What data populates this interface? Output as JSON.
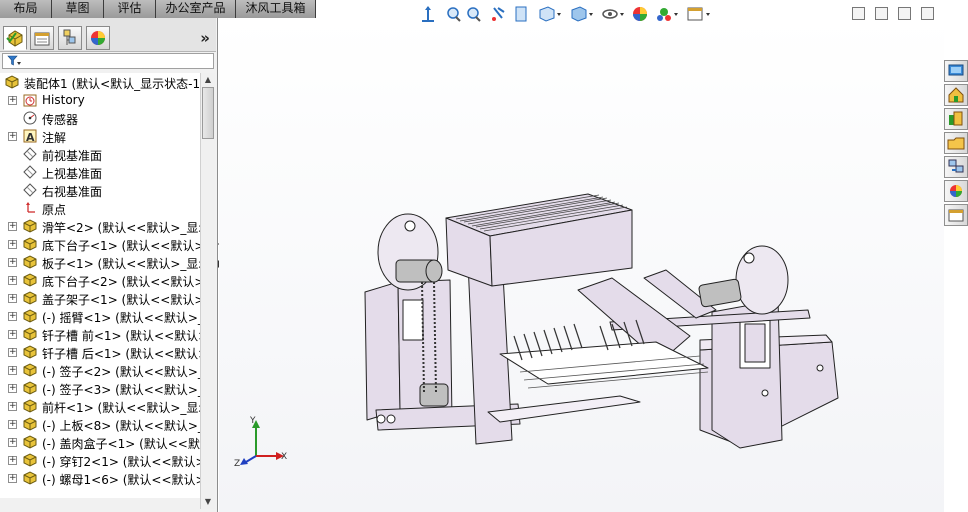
{
  "top_tabs": [
    {
      "label": "布局"
    },
    {
      "label": "草图"
    },
    {
      "label": "评估"
    },
    {
      "label": "办公室产品"
    },
    {
      "label": "沐风工具箱"
    }
  ],
  "panel": {
    "tab_icons": [
      "feature-manager-icon",
      "property-manager-icon",
      "configuration-manager-icon",
      "display-manager-icon"
    ],
    "expand_glyph": "»",
    "filter_icon": "filter-icon"
  },
  "tree": {
    "items": [
      {
        "label": "装配体1 (默认<默认_显示状态-1",
        "icon": "assembly-icon",
        "expander": "none"
      },
      {
        "label": "History",
        "icon": "history-icon",
        "expander": "+"
      },
      {
        "label": "传感器",
        "icon": "sensor-icon",
        "expander": "none"
      },
      {
        "label": "注解",
        "icon": "annotation-icon",
        "expander": "+"
      },
      {
        "label": "前视基准面",
        "icon": "plane-icon",
        "expander": "none"
      },
      {
        "label": "上视基准面",
        "icon": "plane-icon",
        "expander": "none"
      },
      {
        "label": "右视基准面",
        "icon": "plane-icon",
        "expander": "none"
      },
      {
        "label": "原点",
        "icon": "origin-icon",
        "expander": "none"
      },
      {
        "label": "滑竿<2> (默认<<默认>_显示",
        "icon": "part-icon",
        "expander": "+"
      },
      {
        "label": "底下台子<1> (默认<<默认>_",
        "icon": "part-icon",
        "expander": "+"
      },
      {
        "label": "板子<1> (默认<<默认>_显示",
        "icon": "part-icon",
        "expander": "+"
      },
      {
        "label": "底下台子<2> (默认<<默认>_",
        "icon": "part-icon",
        "expander": "+"
      },
      {
        "label": "盖子架子<1> (默认<<默认>_",
        "icon": "part-icon",
        "expander": "+"
      },
      {
        "label": "(-) 摇臂<1> (默认<<默认>_显",
        "icon": "part-icon",
        "expander": "+"
      },
      {
        "label": "钎子槽 前<1> (默认<<默认>_",
        "icon": "part-icon",
        "expander": "+"
      },
      {
        "label": "钎子槽 后<1> (默认<<默认>_",
        "icon": "part-icon",
        "expander": "+"
      },
      {
        "label": "(-) 签子<2> (默认<<默认>_显",
        "icon": "part-icon",
        "expander": "+"
      },
      {
        "label": "(-) 签子<3> (默认<<默认>_显",
        "icon": "part-icon",
        "expander": "+"
      },
      {
        "label": "前杆<1> (默认<<默认>_显示",
        "icon": "part-icon",
        "expander": "+"
      },
      {
        "label": "(-) 上板<8> (默认<<默认>_显",
        "icon": "part-icon",
        "expander": "+"
      },
      {
        "label": "(-) 盖肉盒子<1> (默认<<默认",
        "icon": "part-icon",
        "expander": "+"
      },
      {
        "label": "(-) 穿钉2<1> (默认<<默认>_",
        "icon": "part-icon",
        "expander": "+"
      },
      {
        "label": "(-) 螺母1<6> (默认<<默认>_",
        "icon": "part-icon",
        "expander": "+"
      }
    ]
  },
  "hud_icons": [
    "zoom-to-fit-icon",
    "zoom-to-area-icon",
    "previous-view-icon",
    "section-view-icon",
    "dynamic-annotation-icon",
    "view-orientation-icon",
    "display-style-icon",
    "hide-show-items-icon",
    "edit-appearance-icon",
    "apply-scene-icon",
    "view-settings-icon"
  ],
  "window_buttons": [
    "restore-icon",
    "tile-icon",
    "minimize-icon",
    "close-icon"
  ],
  "task_pane_icons": [
    "solidworks-resources-icon",
    "design-library-icon",
    "file-explorer-icon",
    "view-palette-icon",
    "appearances-icon",
    "custom-properties-icon"
  ],
  "triad": {
    "x_label": "X",
    "y_label": "Y",
    "z_label": "Z"
  },
  "colors": {
    "part_lavender": "#e4dcea",
    "edge": "#222222",
    "tab_bg": "#a9a9a9"
  }
}
